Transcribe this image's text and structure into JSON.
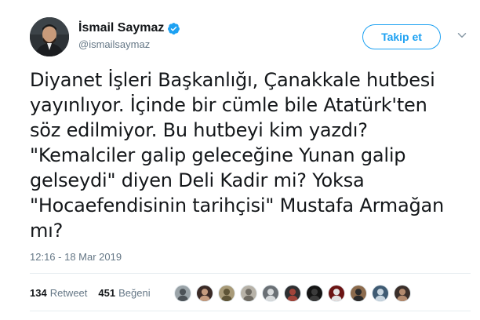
{
  "user": {
    "display_name": "İsmail Saymaz",
    "handle": "@ismailsaymaz",
    "verified": true
  },
  "actions": {
    "follow_label": "Takip et"
  },
  "tweet": {
    "text": "Diyanet İşleri Başkanlığı, Çanakkale hutbesi\nyayınlıyor. İçinde bir cümle bile Atatürk'ten\nsöz edilmiyor. Bu hutbeyi kim yazdı?\n\"Kemalciler galip geleceğine Yunan galip\ngelseydi\" diyen Deli Kadir mi? Yoksa\n\"Hocaefendisinin tarihçisi\" Mustafa Armağan\nmı?",
    "timestamp": "12:16 - 18 Mar 2019"
  },
  "stats": {
    "retweets_count": "134",
    "retweets_label": "Retweet",
    "likes_count": "451",
    "likes_label": "Beğeni"
  },
  "colors": {
    "accent": "#1da1f2",
    "secondary_text": "#657786",
    "divider": "#e6ecf0"
  },
  "liker_avatars": [
    {
      "bg": "#9aa3a8",
      "fg": "#4d5358"
    },
    {
      "bg": "#3a2a26",
      "fg": "#c49b7f"
    },
    {
      "bg": "#a89a78",
      "fg": "#5e5436"
    },
    {
      "bg": "#b7b2a8",
      "fg": "#6e6a62"
    },
    {
      "bg": "#6a7075",
      "fg": "#d8dbdd"
    },
    {
      "bg": "#2e2f31",
      "fg": "#a0443a"
    },
    {
      "bg": "#141414",
      "fg": "#3b3b3b"
    },
    {
      "bg": "#6b1414",
      "fg": "#e3e3e3"
    },
    {
      "bg": "#8c6b4d",
      "fg": "#2a2a2a"
    },
    {
      "bg": "#3f5b73",
      "fg": "#c9d6e0"
    },
    {
      "bg": "#3b2f2a",
      "fg": "#b38a6e"
    }
  ]
}
